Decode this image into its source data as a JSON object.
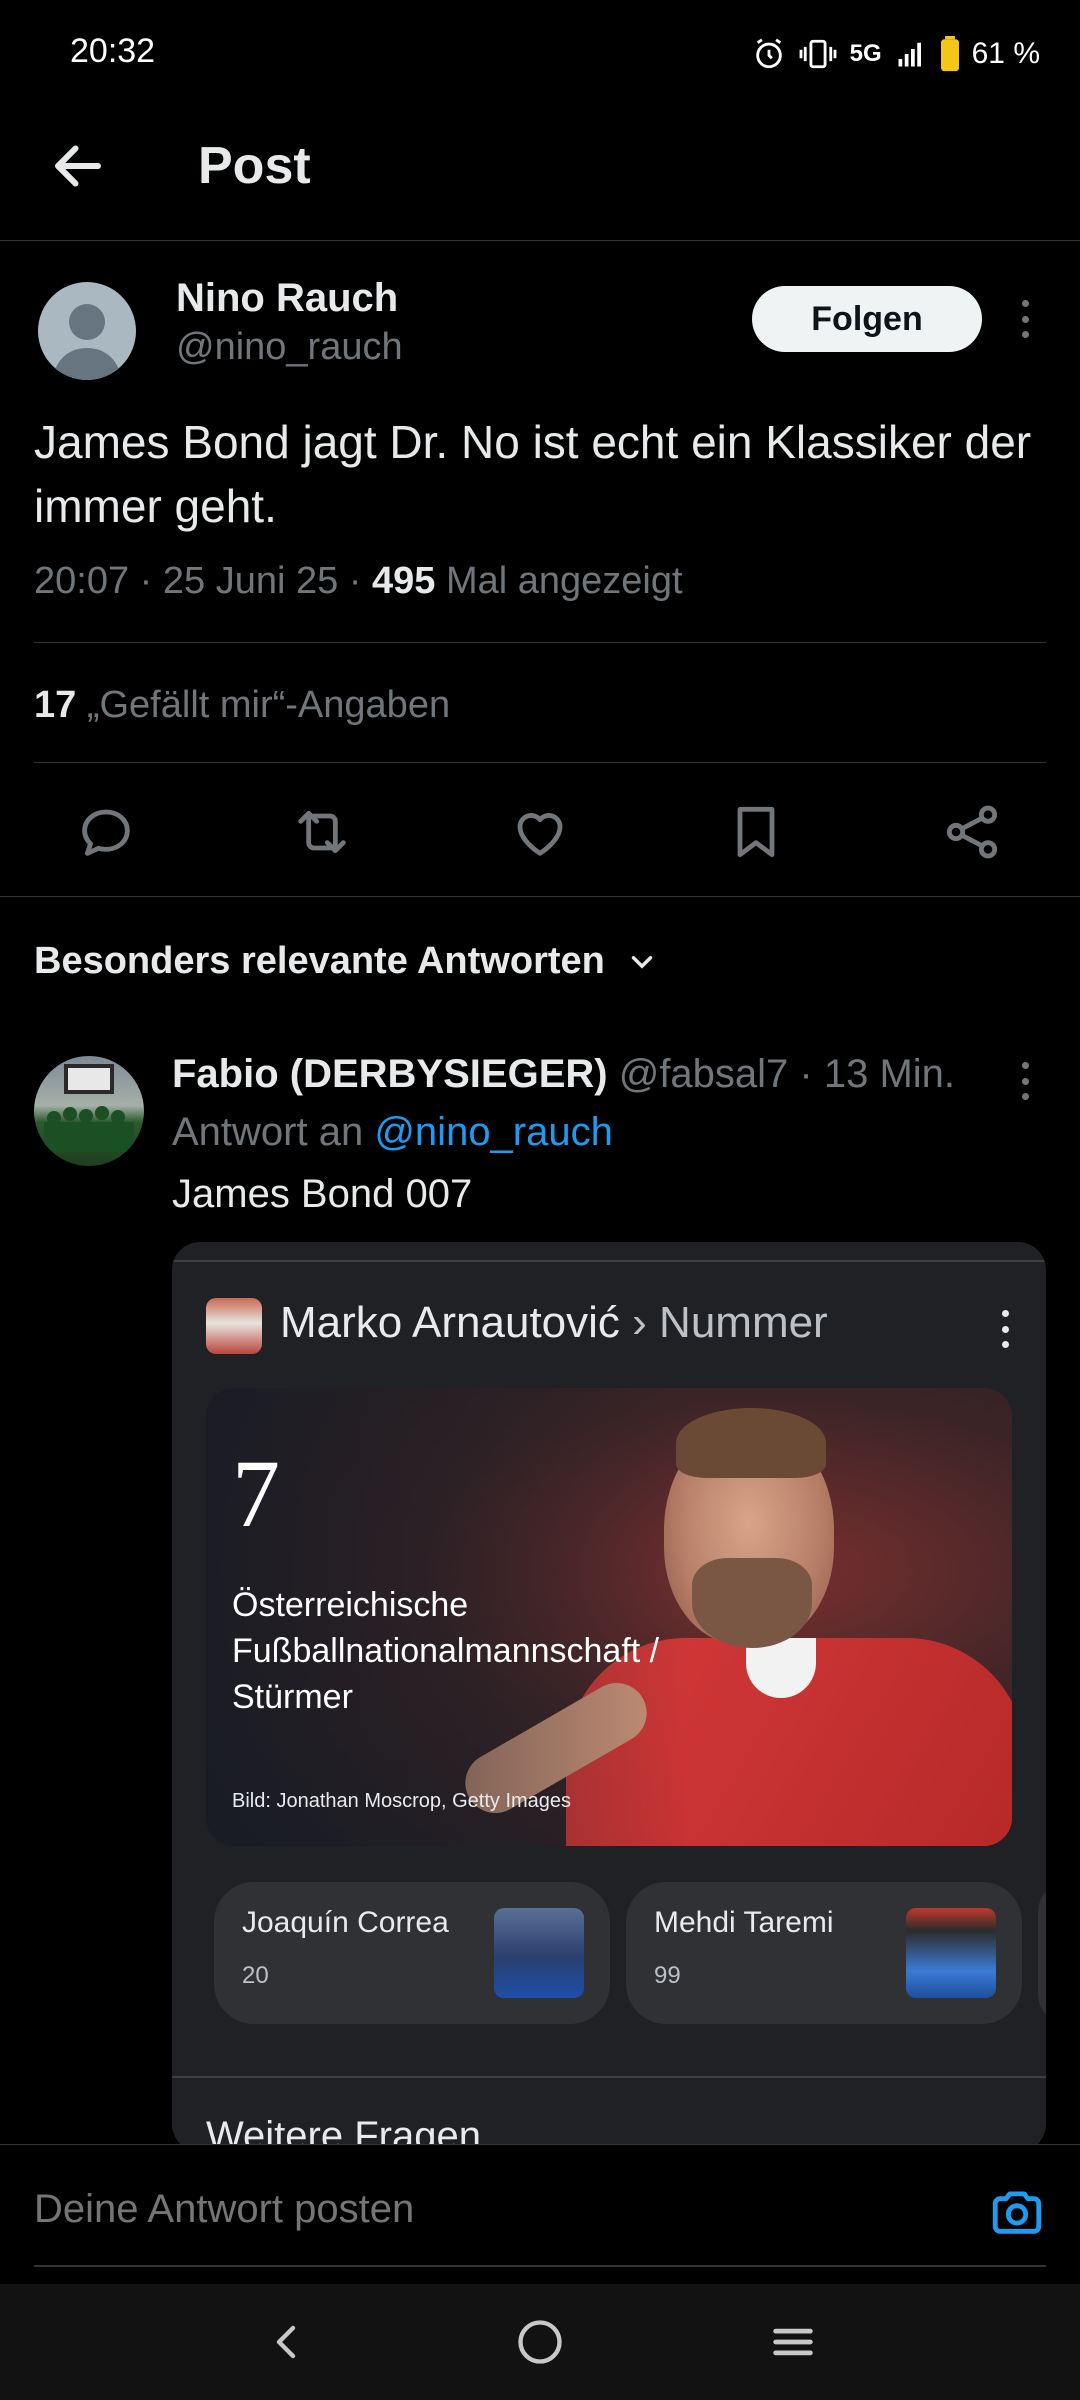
{
  "status_bar": {
    "time": "20:32",
    "network": "5G",
    "battery": "61 %",
    "icons": [
      "alarm-icon",
      "vibrate-icon",
      "signal-icon",
      "battery-icon"
    ]
  },
  "header": {
    "title": "Post"
  },
  "post": {
    "author_name": "Nino Rauch",
    "author_handle": "@nino_rauch",
    "follow_label": "Folgen",
    "text": "James Bond jagt Dr. No ist echt ein Klassiker der immer geht.",
    "meta_prefix": "20:07 · 25 Juni 25 · ",
    "views": "495",
    "views_suffix": " Mal angezeigt",
    "likes_count": "17",
    "likes_label": " „Gefällt mir“-Angaben"
  },
  "actions": [
    "reply-icon",
    "repost-icon",
    "like-icon",
    "bookmark-icon",
    "share-icon"
  ],
  "replies_section": {
    "label": "Besonders relevante Antworten"
  },
  "reply": {
    "name": "Fabio (DERBYSIEGER)",
    "handle_time": " @fabsal7 · 13 Min.",
    "reply_prefix": "Antwort an ",
    "reply_mention": "@nino_rauch",
    "text": "James Bond 007"
  },
  "card": {
    "title": "Marko Arnautović",
    "subtitle": " › Nummer",
    "number": "7",
    "description": "Österreichische Fußballnationalmannschaft / Stürmer",
    "credit": "Bild: Jonathan Moscrop, Getty Images",
    "related": [
      {
        "name": "Joaquín Correa",
        "number": "20"
      },
      {
        "name": "Mehdi Taremi",
        "number": "99"
      }
    ],
    "more_label": "Weitere Fragen"
  },
  "composer": {
    "placeholder": "Deine Antwort posten"
  },
  "colors": {
    "background": "#000000",
    "accent": "#1d9bf0",
    "muted": "#71767b",
    "text": "#e7e9ea"
  }
}
